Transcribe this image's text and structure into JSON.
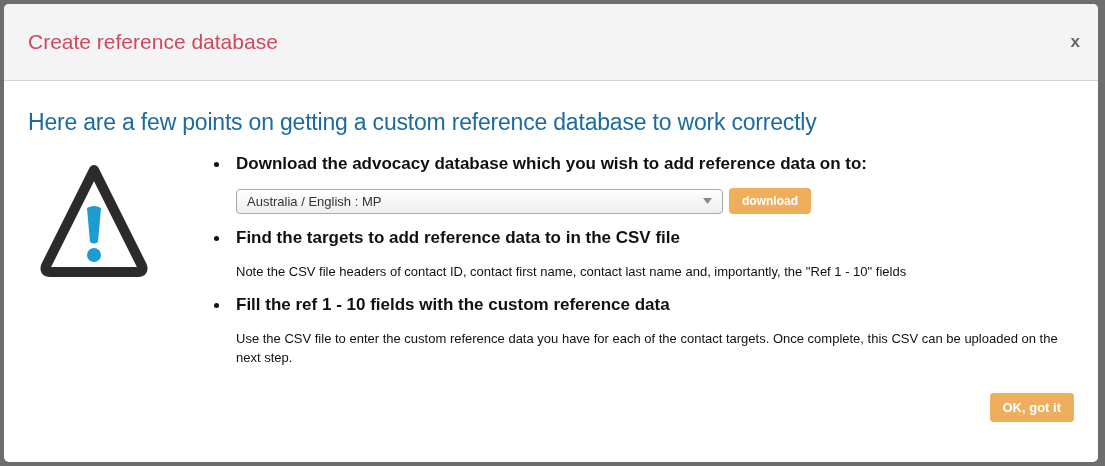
{
  "dialog": {
    "title": "Create reference database",
    "close": "x"
  },
  "heading": "Here are a few points on getting a custom reference database to work correctly",
  "points": [
    {
      "kind": "select",
      "title": "Download the advocacy database which you wish to add reference data on to:",
      "select_value": "Australia / English : MP",
      "button": "download"
    },
    {
      "kind": "note",
      "title": "Find the targets to add reference data to in the CSV file",
      "note": "Note the CSV file headers of contact ID, contact first name, contact last name and, importantly, the \"Ref 1 - 10\" fields"
    },
    {
      "kind": "note",
      "title": "Fill the ref 1 - 10 fields with the custom reference data",
      "note": "Use the CSV file to enter the custom reference data you have for each of the contact targets. Once complete, this CSV can be uploaded on the next step."
    }
  ],
  "confirm_button": "OK, got it"
}
